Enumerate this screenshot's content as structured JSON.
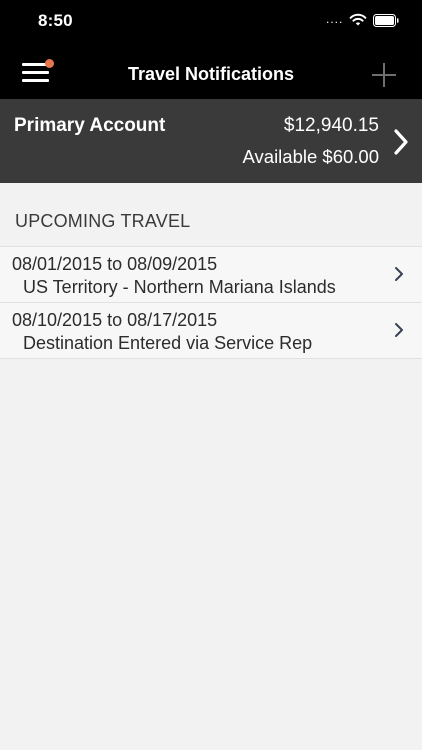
{
  "status_bar": {
    "time": "8:50",
    "signal_dots": "....",
    "wifi_icon": "wifi-icon",
    "battery_icon": "battery-icon"
  },
  "nav": {
    "title": "Travel Notifications",
    "menu_icon": "hamburger-menu-icon",
    "add_icon": "plus-icon",
    "notification_color": "#e8764c"
  },
  "account": {
    "name": "Primary Account",
    "balance": "$12,940.15",
    "available": "Available $60.00"
  },
  "travel": {
    "section_title": "UPCOMING TRAVEL",
    "items": [
      {
        "dates": "08/01/2015 to 08/09/2015",
        "destination": "US Territory - Northern Mariana Islands"
      },
      {
        "dates": "08/10/2015 to 08/17/2015",
        "destination": "Destination Entered via Service Rep"
      }
    ]
  },
  "colors": {
    "background": "#f2f2f2",
    "account_panel": "#3a3a3a",
    "header": "#000000"
  }
}
